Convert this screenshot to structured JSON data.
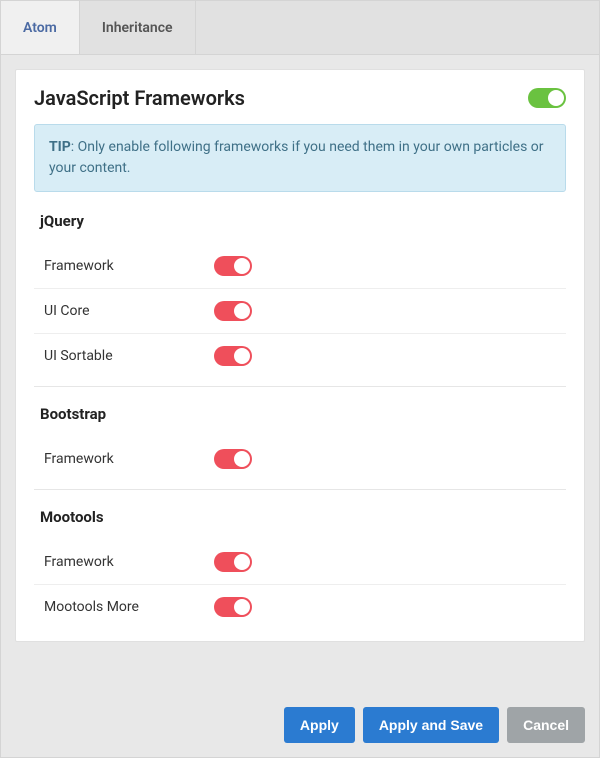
{
  "tabs": {
    "atom": "Atom",
    "inheritance": "Inheritance"
  },
  "panel": {
    "title": "JavaScript Frameworks",
    "master_toggle": {
      "on": true,
      "color": "green"
    }
  },
  "tip": {
    "label": "TIP",
    "text": ": Only enable following frameworks if you need them in your own particles or your content."
  },
  "sections": {
    "jquery": {
      "title": "jQuery",
      "rows": {
        "framework": {
          "label": "Framework",
          "on": true
        },
        "ui_core": {
          "label": "UI Core",
          "on": true
        },
        "ui_sortable": {
          "label": "UI Sortable",
          "on": true
        }
      }
    },
    "bootstrap": {
      "title": "Bootstrap",
      "rows": {
        "framework": {
          "label": "Framework",
          "on": true
        }
      }
    },
    "mootools": {
      "title": "Mootools",
      "rows": {
        "framework": {
          "label": "Framework",
          "on": true
        },
        "more": {
          "label": "Mootools More",
          "on": true
        }
      }
    }
  },
  "buttons": {
    "apply": "Apply",
    "apply_save": "Apply and Save",
    "cancel": "Cancel"
  },
  "colors": {
    "toggle_green": "#6ac240",
    "toggle_red": "#ef4f5b",
    "primary": "#2b7bd1",
    "secondary": "#9fa4a7",
    "tip_bg": "#d8edf6"
  }
}
